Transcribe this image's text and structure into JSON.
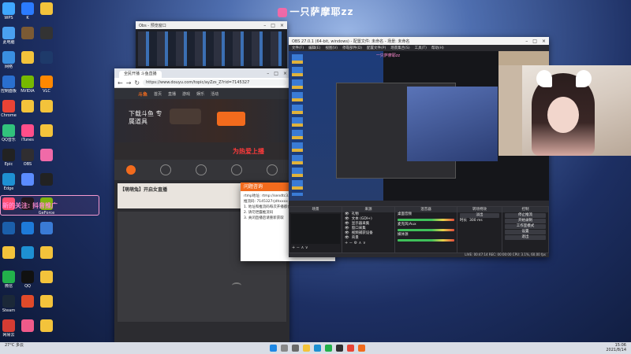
{
  "stream": {
    "title": "一只萨摩耶zz"
  },
  "overlay": {
    "text": "新的关注: 抖音推广"
  },
  "desktop_icons": [
    {
      "label": "WPS",
      "color": "#3fa7ff"
    },
    {
      "label": "K",
      "color": "#2b7bff"
    },
    {
      "label": "",
      "color": "#f3c33b"
    },
    {
      "label": "此电脑",
      "color": "#4aa0f0"
    },
    {
      "label": "",
      "color": "#7b5a34"
    },
    {
      "label": "",
      "color": "#333"
    },
    {
      "label": "网络",
      "color": "#3a8fe0"
    },
    {
      "label": "",
      "color": "#f3c33b"
    },
    {
      "label": "",
      "color": "#1e3a6a"
    },
    {
      "label": "控制面板",
      "color": "#2a6fcf"
    },
    {
      "label": "NVIDIA",
      "color": "#76b900"
    },
    {
      "label": "VLC",
      "color": "#ff8800"
    },
    {
      "label": "Chrome",
      "color": "#e84335"
    },
    {
      "label": "",
      "color": "#f3c33b"
    },
    {
      "label": "",
      "color": "#f3c33b"
    },
    {
      "label": "QQ音乐",
      "color": "#31c27c"
    },
    {
      "label": "iTunes",
      "color": "#ff4e8a"
    },
    {
      "label": "",
      "color": "#f3c33b"
    },
    {
      "label": "Epic",
      "color": "#222"
    },
    {
      "label": "OBS",
      "color": "#302e31"
    },
    {
      "label": "",
      "color": "#f06aa8"
    },
    {
      "label": "Edge",
      "color": "#1e90d2"
    },
    {
      "label": "",
      "color": "#5b8cff"
    },
    {
      "label": "",
      "color": "#222"
    },
    {
      "label": "",
      "color": "#ff4d6d"
    },
    {
      "label": "",
      "color": "#111"
    },
    {
      "label": "GeForce",
      "color": "#76b900"
    },
    {
      "label": "",
      "color": "#1b5faa"
    },
    {
      "label": "",
      "color": "#1e7ad8"
    },
    {
      "label": "",
      "color": "#3a7bd5"
    },
    {
      "label": "",
      "color": "#f3c33b"
    },
    {
      "label": "",
      "color": "#1e90d2"
    },
    {
      "label": "",
      "color": "#f3c33b"
    },
    {
      "label": "微信",
      "color": "#22b04b"
    },
    {
      "label": "QQ",
      "color": "#111"
    },
    {
      "label": "",
      "color": "#f3c33b"
    },
    {
      "label": "Steam",
      "color": "#1b2838"
    },
    {
      "label": "",
      "color": "#e04a2a"
    },
    {
      "label": "",
      "color": "#f3c33b"
    },
    {
      "label": "网易云",
      "color": "#d43c33"
    },
    {
      "label": "",
      "color": "#f05a8a"
    },
    {
      "label": "",
      "color": "#f3c33b"
    }
  ],
  "browser": {
    "tab_title": "全民开播 斗鱼直播",
    "url": "https://www.douyu.com/topic/ayZzs_Z?rid=7145327",
    "nav": [
      "首页",
      "直播",
      "游戏",
      "娱乐",
      "活动"
    ],
    "promo": "下载斗鱼 专属道具",
    "banner_text": "为热爱上播",
    "section_title": "【萌萌兔】开启女直播",
    "user_id": "12"
  },
  "dialog": {
    "title": "问题咨询",
    "lines": [
      "rtmp地址: rtmp://sendtc3.douyu.com/live",
      "推流码: 7145327rjdhxxxx",
      "1. 地址和推流码每次开播都会改变",
      "2. 请勿泄露推流码",
      "3. 关闭直播后请重新获取"
    ],
    "ok_label": "确定"
  },
  "obs": {
    "title": "OBS 27.0.1 (64-bit, windows) - 配置文件: 未命名 - 场景: 未命名",
    "menu": [
      "文件(F)",
      "编辑(E)",
      "视图(V)",
      "停靠部件(D)",
      "配置文件(P)",
      "场景集合(S)",
      "工具(T)",
      "帮助(H)"
    ],
    "panels": {
      "scenes": "场景",
      "sources": "来源",
      "mixer": "混音器",
      "transitions": "转场特效",
      "controls": "控制"
    },
    "sources": [
      "礼物",
      "文本 (GDI+)",
      "显示器采集",
      "窗口采集",
      "视频捕获设备",
      "背景"
    ],
    "mixer": [
      "桌面音频",
      "麦克风/Aux",
      "媒体源"
    ],
    "transition_name": "淡出",
    "duration_label": "时长",
    "duration_value": "300 ms",
    "controls": [
      "停止推流",
      "开始录制",
      "工作室模式",
      "设置",
      "退出"
    ],
    "status": "LIVE: 00:47:14  REC: 00:00:00  CPU: 3.1%, 60.00 fps"
  },
  "taskbar": {
    "weather": "27°C 多云",
    "time": "15:06",
    "date": "2021/8/14"
  }
}
